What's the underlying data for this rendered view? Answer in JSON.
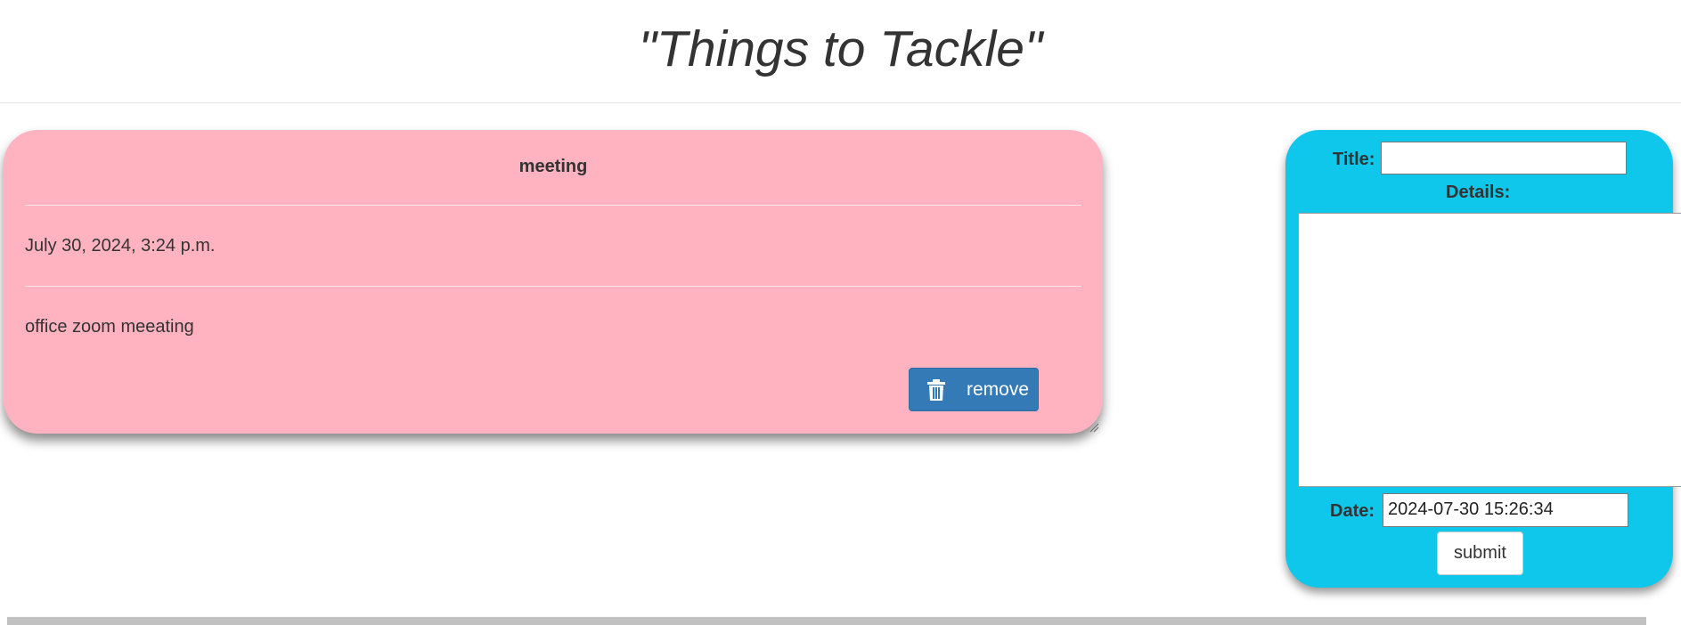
{
  "header": {
    "title": "\"Things to Tackle\""
  },
  "task": {
    "title": "meeting",
    "date": "July 30, 2024, 3:24 p.m.",
    "details": "office zoom meeating",
    "remove_label": "remove",
    "remove_icon": "trash-icon"
  },
  "form": {
    "title_label": "Title:",
    "title_value": "",
    "details_label": "Details:",
    "details_value": "",
    "date_label": "Date:",
    "date_value": "2024-07-30 15:26:34",
    "submit_label": "submit"
  },
  "colors": {
    "card": "#ffb3c0",
    "form_panel": "#0ec7ea",
    "remove_button": "#337ab7"
  }
}
